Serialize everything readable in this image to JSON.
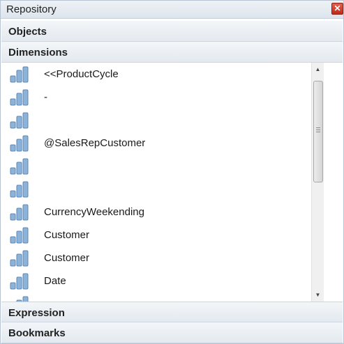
{
  "window": {
    "title": "Repository",
    "close_glyph": "✕",
    "close_icon": "close-icon"
  },
  "sections": {
    "objects": "Objects",
    "dimensions": "Dimensions",
    "expression": "Expression",
    "bookmarks": "Bookmarks"
  },
  "dimension_icon": "dimension-bars-icon",
  "dimensions": [
    {
      "label": "<<ProductCycle"
    },
    {
      "label": "-"
    },
    {
      "label": ""
    },
    {
      "label": "@SalesRepCustomer"
    },
    {
      "label": ""
    },
    {
      "label": ""
    },
    {
      "label": "CurrencyWeekending"
    },
    {
      "label": "Customer"
    },
    {
      "label": "Customer"
    },
    {
      "label": "Date"
    },
    {
      "label": ""
    }
  ],
  "scrollbar": {
    "up_glyph": "▲",
    "down_glyph": "▼"
  },
  "colors": {
    "icon_bar": "#8db3d9",
    "icon_bar_dark": "#5b87b5",
    "header_bg": "#e3e9ef",
    "close_red": "#d0402f"
  }
}
